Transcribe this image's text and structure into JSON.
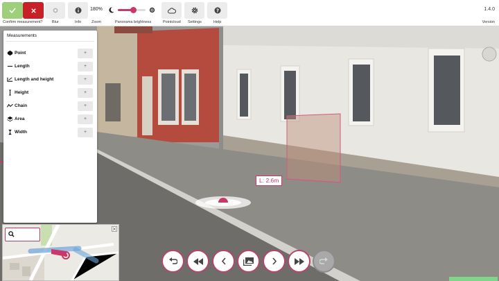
{
  "toolbar": {
    "confirm_label": "Confirm measurement?",
    "blur_label": "Blur",
    "info_label": "Info",
    "zoom_label": "Zoom",
    "zoom_value": "180%",
    "brightness_label": "Panorama brightness",
    "brightness_value": 0.55,
    "pointcloud_label": "Pointcloud",
    "settings_label": "Settings",
    "help_label": "Help",
    "version": "1.4.0",
    "version_label": "Version"
  },
  "measurements": {
    "title": "Measurements",
    "add_symbol": "+",
    "items": [
      {
        "label": "Point",
        "icon": "point-icon"
      },
      {
        "label": "Length",
        "icon": "length-icon"
      },
      {
        "label": "Length and height",
        "icon": "length-height-icon"
      },
      {
        "label": "Height",
        "icon": "height-icon"
      },
      {
        "label": "Chain",
        "icon": "chain-icon"
      },
      {
        "label": "Area",
        "icon": "area-icon"
      },
      {
        "label": "Width",
        "icon": "width-icon"
      }
    ]
  },
  "measurement_overlay": {
    "length_label": "L: 2.6m"
  },
  "navigation": {
    "buttons": [
      "undo-icon",
      "fast-back-icon",
      "back-icon",
      "gallery-icon",
      "forward-icon",
      "fast-forward-icon",
      "redo-icon"
    ]
  },
  "colors": {
    "accent": "#c8386a",
    "confirm": "#9ed07c",
    "cancel": "#c72127"
  }
}
